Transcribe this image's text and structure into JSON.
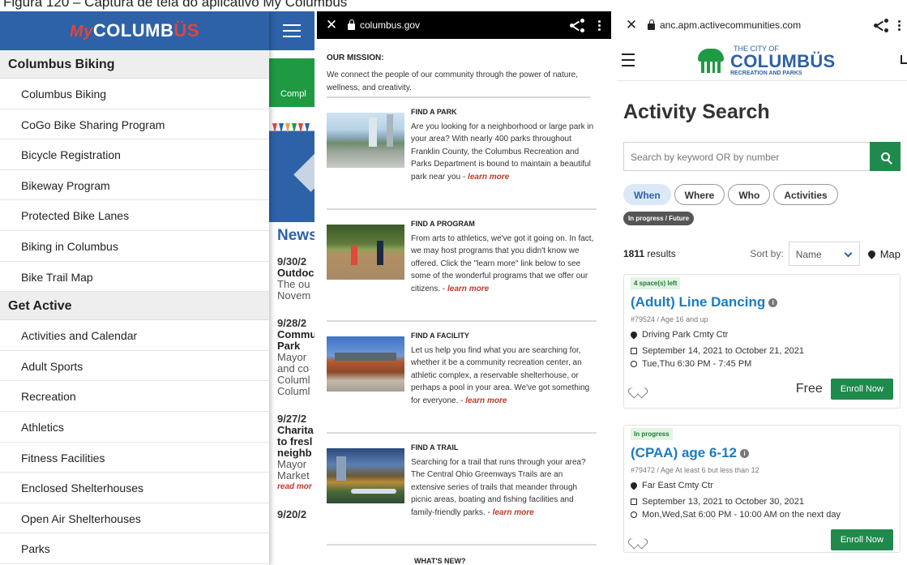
{
  "caption": "Figura 120 – Captura de tela do aplicativo My Columbus",
  "phone1": {
    "logo_my": "My",
    "logo_main": "COLUMB",
    "logo_us": "ÜS",
    "bg_button_text": "Compl",
    "news_title": "News",
    "news": [
      {
        "date": "9/30/2",
        "head": "Outdoc",
        "lines": [
          "The ou",
          "Novem"
        ],
        "read_more": ""
      },
      {
        "date": "9/28/2",
        "head": "Commu",
        "head2": "Park",
        "lines": [
          "Mayor",
          "and co",
          "Columl",
          "Columl"
        ],
        "read_more": ""
      },
      {
        "date": "9/27/2",
        "head": "Charita",
        "head2": "to fresl",
        "head3": "neighb",
        "lines": [
          "Mayor",
          "Market"
        ],
        "read_more": "read mor"
      },
      {
        "date": "9/20/2",
        "head": "",
        "lines": [],
        "read_more": ""
      }
    ],
    "sections": [
      {
        "title": "Columbus Biking",
        "items": [
          "Columbus Biking",
          "CoGo Bike Sharing Program",
          "Bicycle Registration",
          "Bikeway Program",
          "Protected Bike Lanes",
          "Biking in Columbus",
          "Bike Trail Map"
        ]
      },
      {
        "title": "Get Active",
        "items": [
          "Activities and Calendar",
          "Adult Sports",
          "Recreation",
          "Athletics",
          "Fitness Facilities",
          "Enclosed Shelterhouses",
          "Open Air Shelterhouses",
          "Parks"
        ]
      }
    ]
  },
  "phone2": {
    "close": "✕",
    "url": "columbus.gov",
    "mission_heading": "OUR MISSION:",
    "mission_text": "We connect the people of our community through the power of nature, wellness, and creativity.",
    "items": [
      {
        "heading": "FIND A PARK",
        "text": "Are you looking for a neighborhood or large park in your area? With nearly 400 parks throughout Franklin County, the Columbus Recreation and Parks Department is bound to maintain a beautiful park near you - ",
        "link": "learn more"
      },
      {
        "heading": "FIND A PROGRAM",
        "text": "From arts to athletics, we've got it going on. In fact, we may host programs that you didn't know we offered. Click the \"learn more\" link below to see some of the wonderful programs that we offer our citizens.  - ",
        "link": "learn more"
      },
      {
        "heading": "FIND A FACILITY",
        "text": "Let us help you find what you are searching for, whether it be a community recreation center, an athletic complex, a reservable shelterhouse, or perhaps a pool in your area. We've got something for everyone. - ",
        "link": "learn more"
      },
      {
        "heading": "FIND A TRAIL",
        "text": "Searching for a trail that runs through your area? The Central Ohio Greenways Trails are an extensive series of trails that meander through picnic areas, boating and fishing facilities and family-friendly parks. - ",
        "link": "learn more"
      }
    ],
    "whats_new": "WHAT'S NEW?"
  },
  "phone3": {
    "close": "✕",
    "url": "anc.apm.activecommunities.com",
    "logo_line1": "THE CITY OF",
    "logo_line2": "COLUMBÜS",
    "logo_line3": "RECREATION AND PARKS",
    "title": "Activity Search",
    "search_placeholder": "Search by keyword OR by number",
    "filters": [
      "When",
      "Where",
      "Who",
      "Activities"
    ],
    "tag": "In progress / Future",
    "results_count": "1811",
    "results_label": " results",
    "sort_label": "Sort by:",
    "sort_value": "Name",
    "map_label": "Map",
    "cards": [
      {
        "badge": "4 space(s) left",
        "name": "(Adult) Line Dancing",
        "meta": "#79524 / Age 16 and up",
        "location": "Driving Park Cmty Ctr",
        "dates": "September 14, 2021 to October 21, 2021",
        "time": "Tue,Thu 6:30 PM - 7:45 PM",
        "price": "Free",
        "button": "Enroll Now"
      },
      {
        "badge": "In progress",
        "name": "(CPAA) age 6-12",
        "meta": "#79472 / Age At least 6 but less than 12",
        "location": "Far East Cmty Ctr",
        "dates": "September 13, 2021 to October 30, 2021",
        "time": "Mon,Wed,Sat 6:00 PM - 10:00 AM on the next day",
        "price": "",
        "button": "Enroll Now"
      }
    ]
  }
}
